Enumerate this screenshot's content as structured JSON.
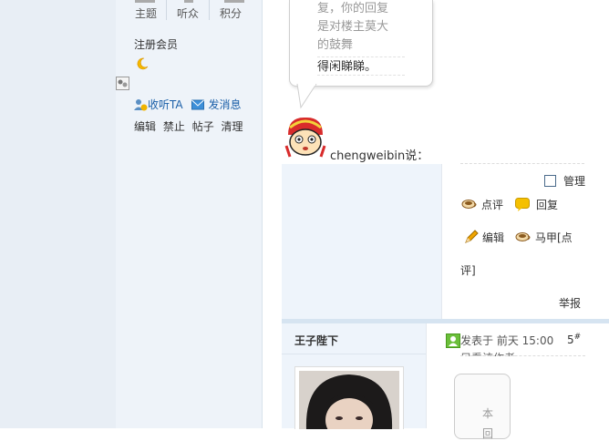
{
  "profile": {
    "stats": [
      {
        "label": "主题"
      },
      {
        "label": "听众"
      },
      {
        "label": "积分"
      }
    ],
    "role": "注册会员",
    "follow_label": "收听TA",
    "message_label": "发消息",
    "moderation": [
      "编辑",
      "禁止",
      "帖子",
      "清理"
    ]
  },
  "bubble": {
    "lines": [
      "复，你的回复",
      "是对楼主莫大",
      "的鼓舞"
    ],
    "last_line": "得闲睇睇。"
  },
  "comment": {
    "speaker": "chengweibin说：",
    "manage_label": "管理",
    "actions": {
      "rate": "点评",
      "reply": "回复",
      "edit": "编辑",
      "vest_line1": "马甲[点",
      "vest_line2": "评]"
    },
    "report": "举报"
  },
  "post": {
    "username": "王子陛下",
    "posted_prefix": "发表于 ",
    "posted_time": "前天 15:00",
    "floor": "5",
    "floor_suffix": "#",
    "only_author": "只看该作者",
    "side_chars": [
      "本",
      "回"
    ]
  },
  "colors": {
    "sidebar_bg": "#eef3f9",
    "link": "#1a5fa8",
    "divider": "#d6e4f1"
  }
}
